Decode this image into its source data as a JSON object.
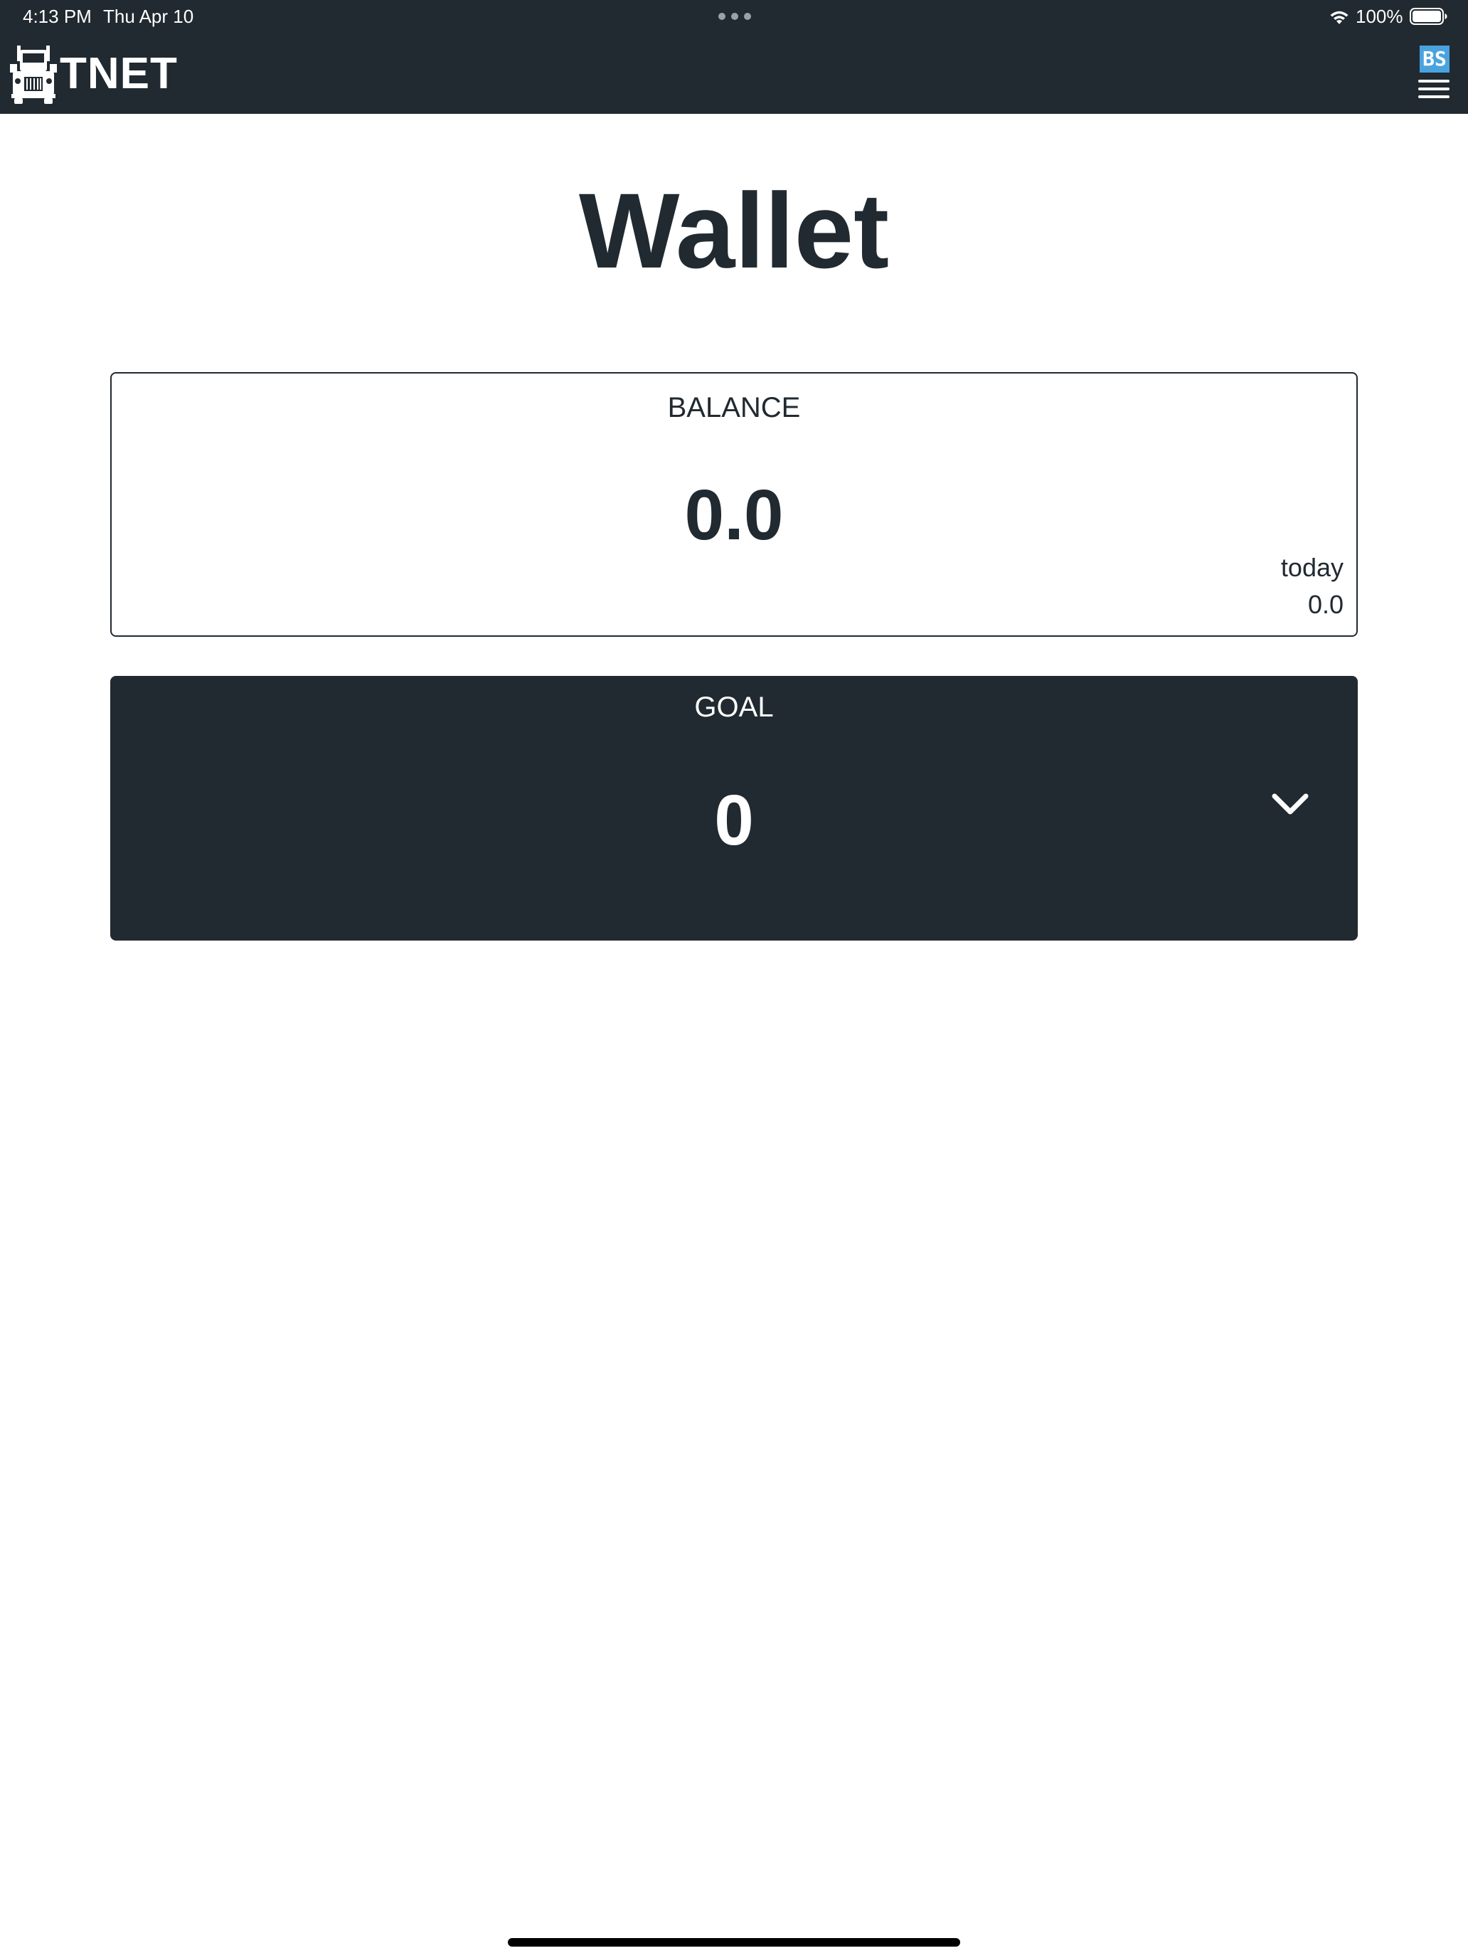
{
  "status_bar": {
    "time": "4:13 PM",
    "date": "Thu Apr 10",
    "battery": "100%",
    "icons": [
      "wifi-icon",
      "battery-icon",
      "multitasking-dots-icon"
    ]
  },
  "header": {
    "brand": "TNET",
    "logo_icon": "truck-icon",
    "user_initials": "BS",
    "menu_icon": "hamburger-menu-icon",
    "colors": {
      "background": "#212a30",
      "badge": "#4aa3df"
    }
  },
  "page": {
    "title": "Wallet"
  },
  "balance": {
    "label": "BALANCE",
    "value": "0.0",
    "today_label": "today",
    "today_value": "0.0"
  },
  "goal": {
    "label": "GOAL",
    "value": "0",
    "toggle_icon": "chevron-down-icon"
  }
}
